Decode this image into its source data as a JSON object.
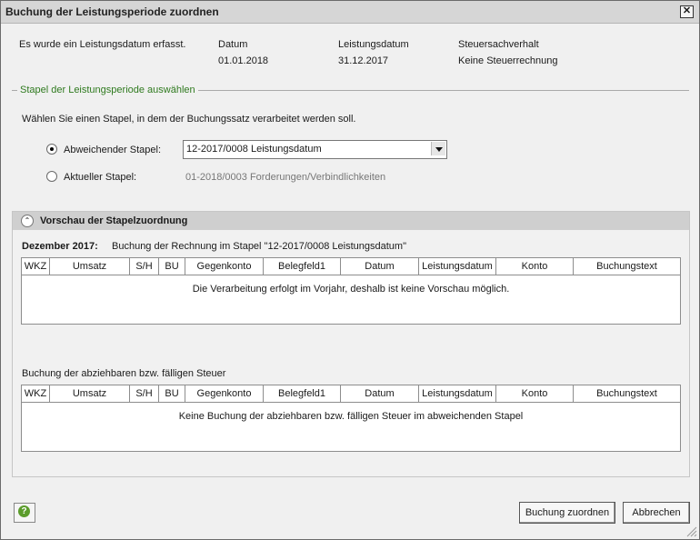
{
  "window": {
    "title": "Buchung der Leistungsperiode zuordnen"
  },
  "info": {
    "message": "Es wurde ein Leistungsdatum erfasst.",
    "datum_label": "Datum",
    "datum_value": "01.01.2018",
    "leistungsdatum_label": "Leistungsdatum",
    "leistungsdatum_value": "31.12.2017",
    "steuer_label": "Steuersachverhalt",
    "steuer_value": "Keine Steuerrechnung"
  },
  "selection": {
    "group_title": "Stapel der Leistungsperiode auswählen",
    "instruction": "Wählen Sie einen Stapel, in dem der Buchungssatz verarbeitet werden soll.",
    "option_abweichend": "Abweichender Stapel:",
    "selected_stapel": "12-2017/0008  Leistungsdatum",
    "option_aktuell": "Aktueller Stapel:",
    "aktueller_stapel_value": "01-2018/0003 Forderungen/Verbindlichkeiten"
  },
  "preview": {
    "title": "Vorschau der Stapelzuordnung",
    "month_label": "Dezember 2017:",
    "month_desc": "Buchung der Rechnung im Stapel \"12-2017/0008 Leistungsdatum\"",
    "empty_message": "Die Verarbeitung erfolgt im Vorjahr, deshalb ist keine Vorschau möglich.",
    "tax_heading": "Buchung der abziehbaren bzw. fälligen Steuer",
    "tax_empty_message": "Keine Buchung der abziehbaren bzw. fälligen Steuer im abweichenden Stapel"
  },
  "columns": [
    "WKZ",
    "Umsatz",
    "S/H",
    "BU",
    "Gegenkonto",
    "Belegfeld1",
    "Datum",
    "Leistungsdatum",
    "Konto",
    "Buchungstext"
  ],
  "buttons": {
    "assign": "Buchung zuordnen",
    "cancel": "Abbrechen"
  },
  "icons": {
    "close": "close-icon",
    "help": "help-icon",
    "collapse": "chevron-up-icon"
  }
}
